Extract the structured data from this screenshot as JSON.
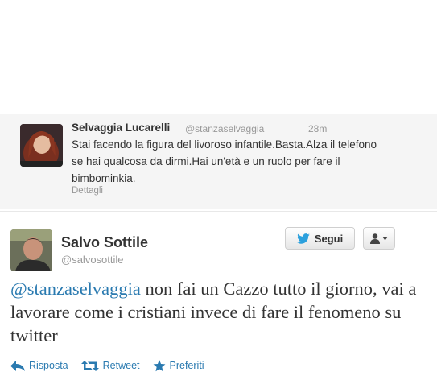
{
  "reply": {
    "name": "Selvaggia Lucarelli",
    "handle": "@stanzaselvaggia",
    "time": "28m",
    "text": "Stai facendo la figura del livoroso infantile.Basta.Alza il telefono se hai qualcosa da dirmi.Hai un'età e un ruolo per fare il bimbominkia.",
    "details_label": "Dettagli"
  },
  "tweet": {
    "name": "Salvo Sottile",
    "handle": "@salvosottile",
    "follow_label": "Segui",
    "mention": "@stanzaselvaggia",
    "text": " non fai un Cazzo tutto il giorno, vai a lavorare come i cristiani invece di fare il fenomeno su twitter"
  },
  "actions": {
    "reply_label": "Risposta",
    "retweet_label": "Retweet",
    "favorite_label": "Preferiti"
  },
  "colors": {
    "link": "#2a7ab0",
    "twitter_bird": "#2ba0dd"
  },
  "icons": {
    "follow": "twitter-bird-icon",
    "user_menu": "user-icon",
    "reply": "reply-arrow-icon",
    "retweet": "retweet-icon",
    "favorite": "star-icon"
  }
}
